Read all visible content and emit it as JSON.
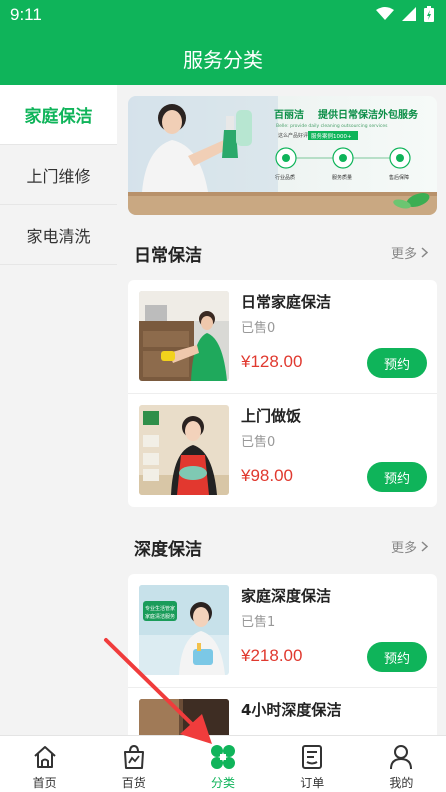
{
  "status_bar": {
    "time": "9:11"
  },
  "header": {
    "title": "服务分类"
  },
  "sidebar": {
    "items": [
      {
        "label": "家庭保洁",
        "active": true
      },
      {
        "label": "上门维修",
        "active": false
      },
      {
        "label": "家电清洗",
        "active": false
      }
    ]
  },
  "banner": {
    "brand": "百丽洁",
    "headline": "提供日常保洁外包服务",
    "english": "Belle: provide daily cleaning outsourcing services",
    "sub1": "这么产品好评",
    "sub2": "服务案例1000+",
    "features": [
      "行业品质",
      "服务质量",
      "售后保障"
    ]
  },
  "sections": [
    {
      "title": "日常保洁",
      "more": "更多",
      "items": [
        {
          "title": "日常家庭保洁",
          "sold": "已售0",
          "price": "¥128.00",
          "button": "预约"
        },
        {
          "title": "上门做饭",
          "sold": "已售0",
          "price": "¥98.00",
          "button": "预约"
        }
      ]
    },
    {
      "title": "深度保洁",
      "more": "更多",
      "items": [
        {
          "title": "家庭深度保洁",
          "sold": "已售1",
          "price": "¥218.00",
          "button": "预约"
        },
        {
          "title": "4小时深度保洁"
        }
      ]
    }
  ],
  "thumb_text": {
    "deep_clean_line1": "专业生活管家",
    "deep_clean_line2": "家庭清洁服务"
  },
  "tabbar": {
    "tabs": [
      {
        "label": "首页",
        "icon": "home-icon"
      },
      {
        "label": "百货",
        "icon": "shopping-bag-icon"
      },
      {
        "label": "分类",
        "icon": "category-icon",
        "active": true
      },
      {
        "label": "订单",
        "icon": "order-icon"
      },
      {
        "label": "我的",
        "icon": "profile-icon"
      }
    ]
  },
  "colors": {
    "brand": "#0fb45a",
    "price": "#e0392f",
    "annotation_arrow": "#f03c3c"
  }
}
